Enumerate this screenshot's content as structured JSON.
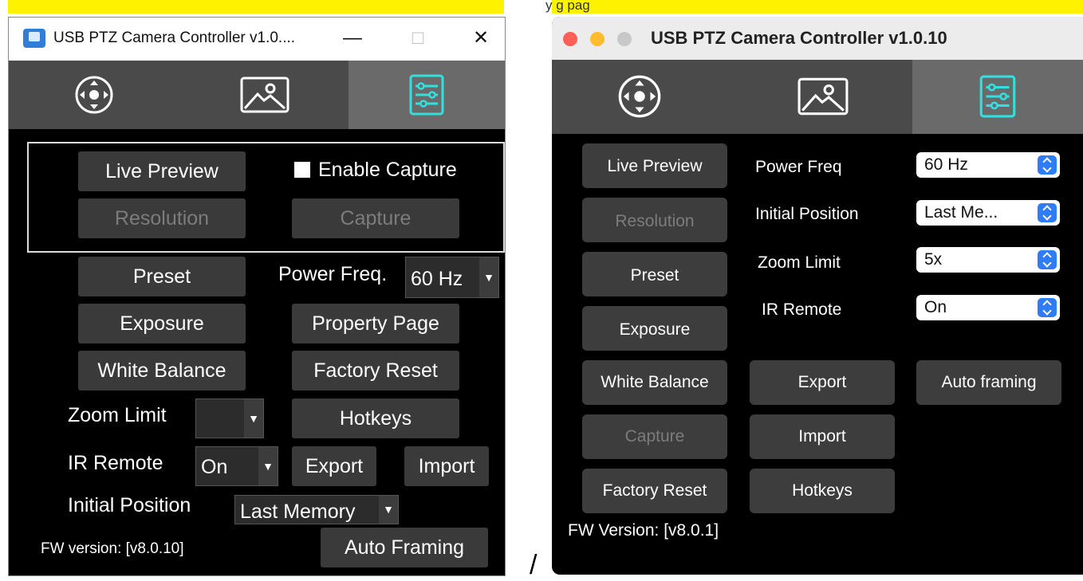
{
  "header_fragment": "y                 g            pag",
  "separator": "/",
  "colors": {
    "highlight": "#fff200",
    "accent_cyan": "#33e0e0",
    "mac_popup_blue": "#2e7cf6"
  },
  "windows_app": {
    "title": "USB PTZ Camera Controller v1.0....",
    "window_controls": {
      "minimize": "—",
      "maximize": "□",
      "close": "✕"
    },
    "tabs": [
      {
        "icon": "joystick-icon"
      },
      {
        "icon": "image-icon"
      },
      {
        "icon": "settings-sliders-icon",
        "active": true
      }
    ],
    "live_preview": "Live Preview",
    "enable_capture": "Enable Capture",
    "enable_capture_checked": true,
    "resolution": "Resolution",
    "capture": "Capture",
    "preset": "Preset",
    "power_freq_label": "Power Freq.",
    "power_freq_value": "60 Hz",
    "exposure": "Exposure",
    "property_page": "Property Page",
    "white_balance": "White Balance",
    "factory_reset": "Factory Reset",
    "zoom_limit_label": "Zoom Limit",
    "zoom_limit_value": "",
    "hotkeys": "Hotkeys",
    "ir_remote_label": "IR Remote",
    "ir_remote_value": "On",
    "export": "Export",
    "import": "Import",
    "initial_position_label": "Initial Position",
    "initial_position_value": "Last Memory",
    "fw_version": "FW version:   [v8.0.10]",
    "auto_framing": "Auto Framing"
  },
  "mac_app": {
    "title": "USB PTZ Camera Controller v1.0.10",
    "tabs": [
      {
        "icon": "joystick-icon"
      },
      {
        "icon": "image-icon"
      },
      {
        "icon": "settings-sliders-icon",
        "active": true
      }
    ],
    "live_preview": "Live Preview",
    "resolution": "Resolution",
    "preset": "Preset",
    "exposure": "Exposure",
    "white_balance": "White Balance",
    "capture": "Capture",
    "factory_reset": "Factory Reset",
    "power_freq_label": "Power Freq",
    "power_freq_value": "60 Hz",
    "initial_position_label": "Initial Position",
    "initial_position_value": "Last Me...",
    "zoom_limit_label": "Zoom Limit",
    "zoom_limit_value": "5x",
    "ir_remote_label": "IR Remote",
    "ir_remote_value": "On",
    "export": "Export",
    "import": "Import",
    "hotkeys": "Hotkeys",
    "auto_framing": "Auto framing",
    "fw_version": "FW Version: [v8.0.1]"
  }
}
